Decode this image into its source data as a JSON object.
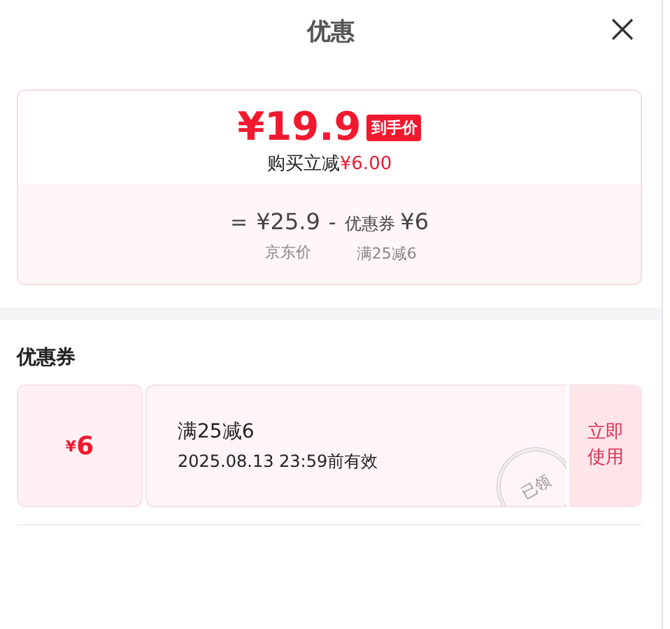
{
  "title": "优惠",
  "summary": {
    "price": "¥19.9",
    "badge": "到手价",
    "saving_label": "购买立减",
    "saving_amount": "¥6.00",
    "formula": [
      {
        "kind": "op",
        "text": "="
      },
      {
        "kind": "term",
        "value": "¥25.9",
        "caption": "京东价"
      },
      {
        "kind": "op",
        "text": "-"
      },
      {
        "kind": "term",
        "prefix": "优惠券",
        "value": "¥6",
        "caption": "满25减6"
      }
    ]
  },
  "section_title": "优惠券",
  "coupons": [
    {
      "symbol": "¥",
      "amount": "6",
      "name": "满25减6",
      "validity": "2025.08.13 23:59前有效",
      "stamp": "已领",
      "action": "立即使用"
    }
  ]
}
